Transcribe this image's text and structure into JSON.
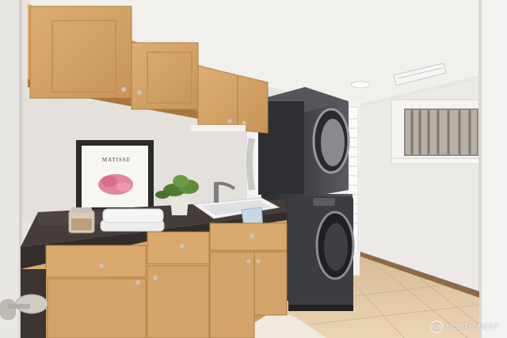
{
  "photo": {
    "poster_text": "MATISSE",
    "watermark_text": "NORTHWEST",
    "watermark_icon": "nw-circle-logo"
  },
  "colors": {
    "wall": "#e9e7e3",
    "ceiling": "#f2f1ee",
    "cabinet_wood": "#d5a66a",
    "countertop_granite": "#3e3836",
    "appliance_dark": "#3a3b3f",
    "floor_tile": "#e8cfae"
  }
}
